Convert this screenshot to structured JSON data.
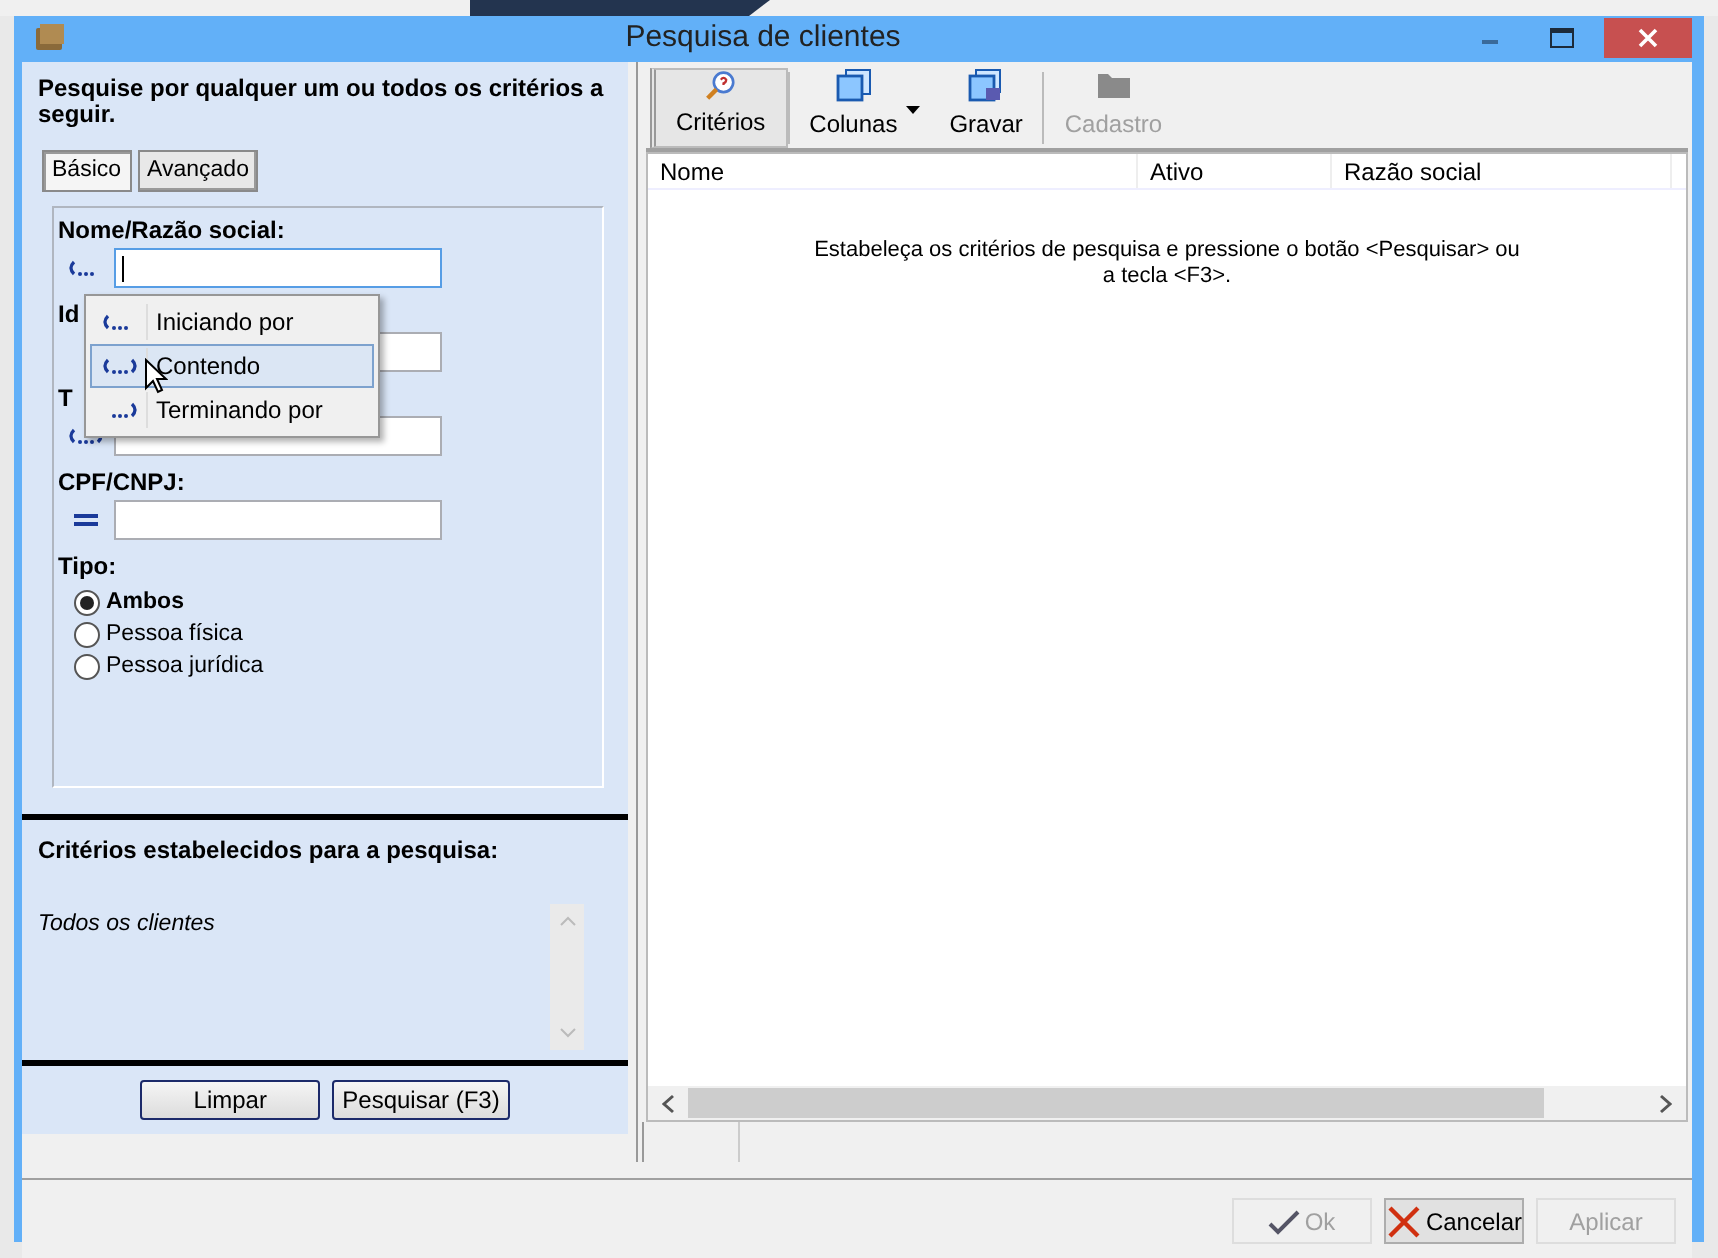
{
  "window": {
    "title": "Pesquisa de clientes"
  },
  "left_panel": {
    "instruction": "Pesquise por qualquer um ou todos os critérios a seguir.",
    "tabs": [
      {
        "label": "Básico",
        "selected": true
      },
      {
        "label": "Avançado",
        "selected": false
      }
    ],
    "fields": [
      {
        "label": "Nome/Razão social:",
        "kind": "starts",
        "focused": true
      },
      {
        "label": "Id",
        "kind": "none",
        "focused": false
      },
      {
        "label": "T",
        "kind": "contains",
        "focused": false
      },
      {
        "label": "CPF/CNPJ:",
        "kind": "equals",
        "focused": false
      }
    ],
    "tipo": {
      "label": "Tipo:",
      "options": [
        {
          "label": "Ambos",
          "selected": true
        },
        {
          "label": "Pessoa física",
          "selected": false
        },
        {
          "label": "Pessoa jurídica",
          "selected": false
        }
      ]
    },
    "criteria": {
      "title": "Critérios estabelecidos para a pesquisa:",
      "text": "Todos os clientes"
    },
    "buttons": [
      "Limpar",
      "Pesquisar (F3)"
    ]
  },
  "match_menu": {
    "items": [
      {
        "label": "Iniciando por",
        "kind": "starts",
        "selected": false
      },
      {
        "label": "Contendo",
        "kind": "contains",
        "selected": true
      },
      {
        "label": "Terminando por",
        "kind": "ends",
        "selected": false
      }
    ]
  },
  "toolbar": [
    {
      "label": "Critérios",
      "kind": "criteria",
      "pressed": true,
      "disabled": false,
      "has_menu": false
    },
    {
      "label": "Colunas",
      "kind": "columns",
      "pressed": false,
      "disabled": false,
      "has_menu": true
    },
    {
      "label": "Gravar",
      "kind": "save",
      "pressed": false,
      "disabled": false,
      "has_menu": false
    },
    {
      "label": "Cadastro",
      "kind": "folder",
      "pressed": false,
      "disabled": true,
      "has_menu": false
    }
  ],
  "table": {
    "columns": [
      "Nome",
      "Ativo",
      "Razão social"
    ],
    "empty_message": "Estabeleça os critérios de pesquisa e pressione o botão <Pesquisar> ou a tecla <F3>."
  },
  "dialog_buttons": [
    {
      "label": "Ok",
      "kind": "ok",
      "disabled": true
    },
    {
      "label": "Cancelar",
      "kind": "cancel",
      "disabled": false
    },
    {
      "label": "Aplicar",
      "kind": "none",
      "disabled": true
    }
  ]
}
